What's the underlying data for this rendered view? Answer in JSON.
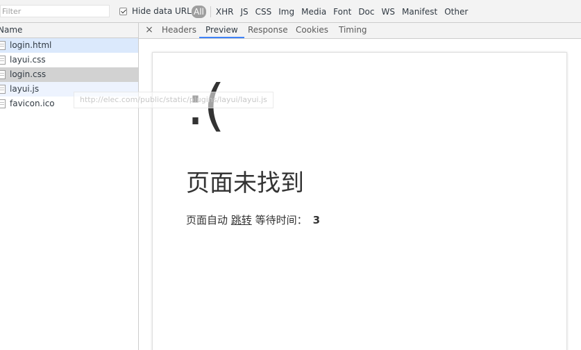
{
  "filter": {
    "placeholder": "Filter",
    "hide_data_urls_label": "Hide data URLs",
    "hide_data_urls_checked": true
  },
  "type_filters": {
    "active": "All",
    "items": [
      "XHR",
      "JS",
      "CSS",
      "Img",
      "Media",
      "Font",
      "Doc",
      "WS",
      "Manifest",
      "Other"
    ]
  },
  "request_list": {
    "header": "Name",
    "rows": [
      {
        "name": "login.html",
        "state": "selected"
      },
      {
        "name": "layui.css",
        "state": "normal"
      },
      {
        "name": "login.css",
        "state": "hovered"
      },
      {
        "name": "layui.js",
        "state": "alt"
      },
      {
        "name": "favicon.ico",
        "state": "normal"
      }
    ],
    "tooltip": "http://elec.com/public/static/plugins/layui/layui.js"
  },
  "detail": {
    "close_glyph": "×",
    "tabs": [
      "Headers",
      "Preview",
      "Response",
      "Cookies",
      "Timing"
    ],
    "active_tab": "Preview"
  },
  "preview": {
    "face": ":(",
    "title": "页面未找到",
    "redirect_prefix": "页面自动",
    "redirect_link": "跳转",
    "redirect_suffix": "等待时间：",
    "countdown": "3"
  },
  "colors": {
    "accent": "#3e82f7",
    "selected_row": "#dbe9fc",
    "hovered_row": "#d2d2d2",
    "all_badge": "#9e9e9e"
  }
}
